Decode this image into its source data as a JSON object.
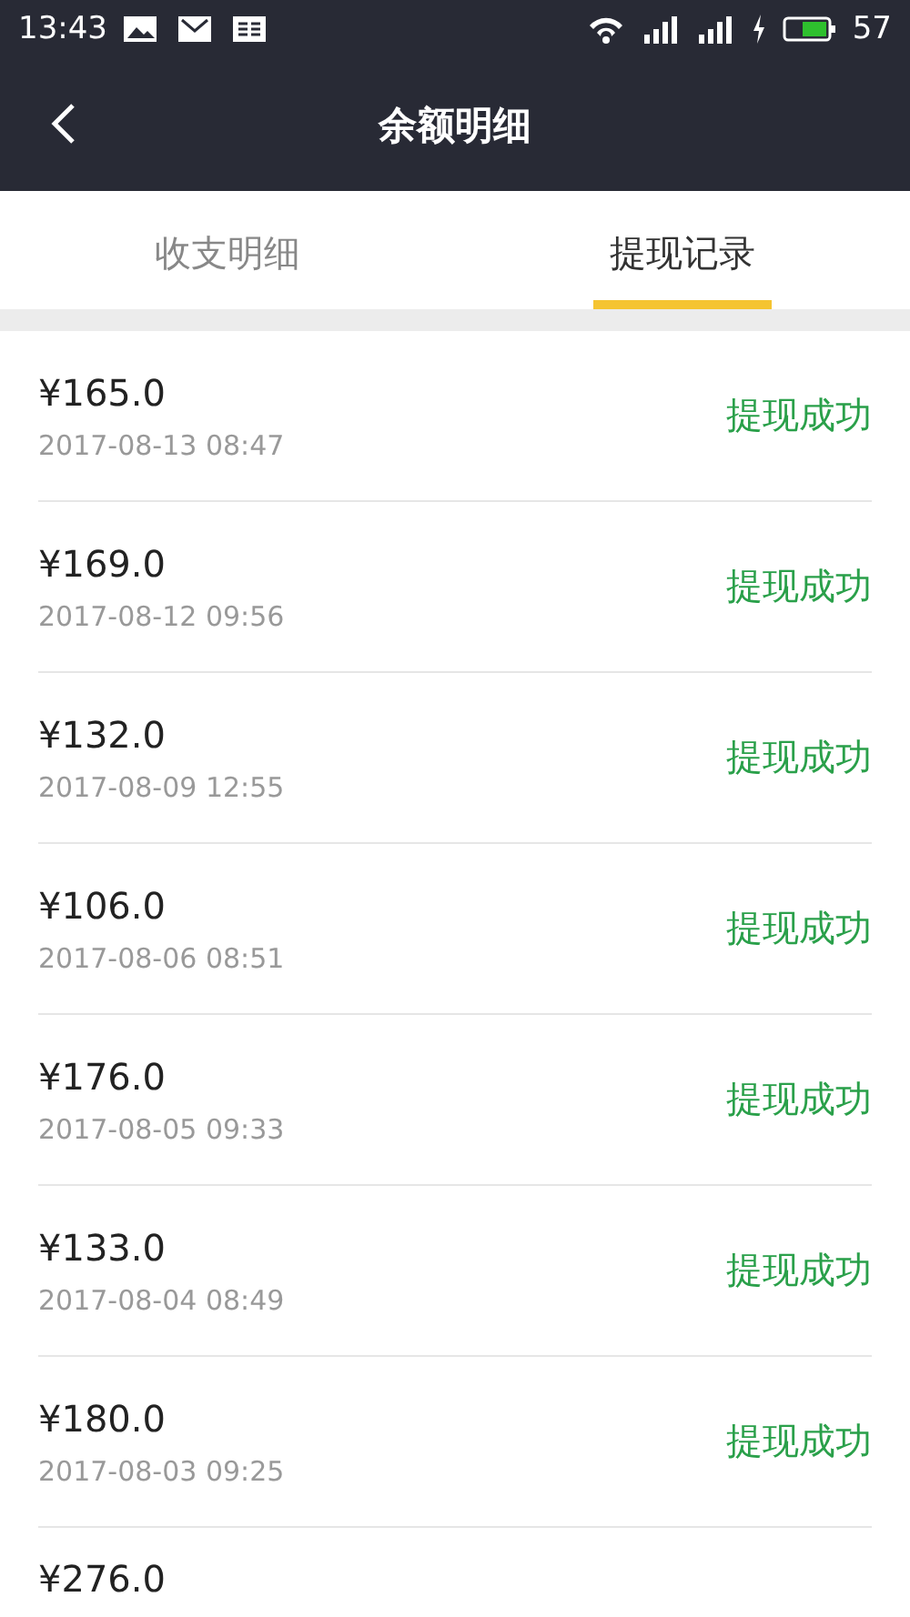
{
  "status_bar": {
    "time": "13:43",
    "battery": "57"
  },
  "header": {
    "title": "余额明细"
  },
  "tabs": [
    {
      "label": "收支明细",
      "selected": false
    },
    {
      "label": "提现记录",
      "selected": true
    }
  ],
  "records": [
    {
      "amount": "¥165.0",
      "time": "2017-08-13 08:47",
      "status": "提现成功"
    },
    {
      "amount": "¥169.0",
      "time": "2017-08-12 09:56",
      "status": "提现成功"
    },
    {
      "amount": "¥132.0",
      "time": "2017-08-09 12:55",
      "status": "提现成功"
    },
    {
      "amount": "¥106.0",
      "time": "2017-08-06 08:51",
      "status": "提现成功"
    },
    {
      "amount": "¥176.0",
      "time": "2017-08-05 09:33",
      "status": "提现成功"
    },
    {
      "amount": "¥133.0",
      "time": "2017-08-04 08:49",
      "status": "提现成功"
    },
    {
      "amount": "¥180.0",
      "time": "2017-08-03 09:25",
      "status": "提现成功"
    },
    {
      "amount": "¥276.0"
    }
  ]
}
